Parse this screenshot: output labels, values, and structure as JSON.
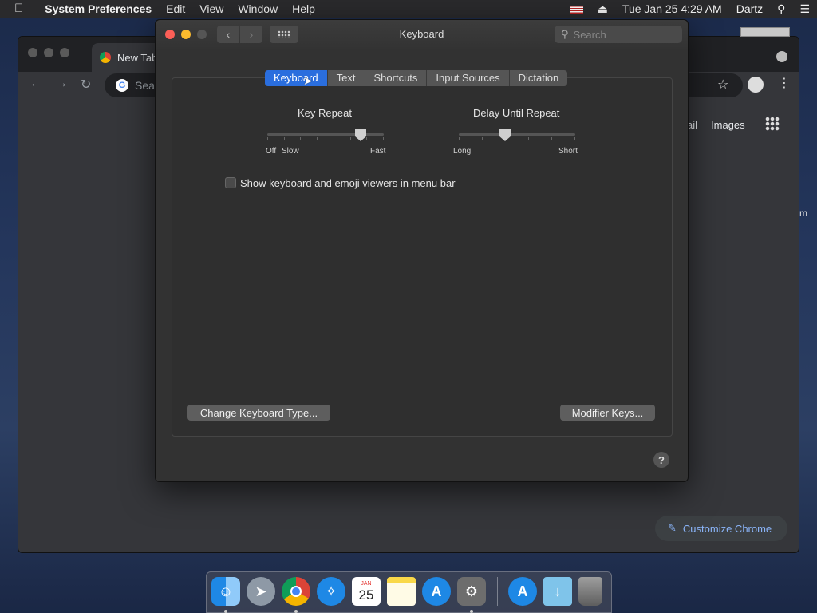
{
  "menubar": {
    "apple_icon": "apple-icon",
    "app_name": "System Preferences",
    "menus": [
      "Edit",
      "View",
      "Window",
      "Help"
    ],
    "datetime": "Tue Jan 25  4:29 AM",
    "user": "Dartz"
  },
  "chrome": {
    "tab_title": "New Tab",
    "omnibox_placeholder": "Sear",
    "link_gmail": "ail",
    "link_images": "Images",
    "customize_label": "Customize Chrome",
    "edge_text": "m"
  },
  "prefs": {
    "title": "Keyboard",
    "search_placeholder": "Search",
    "tabs": [
      "Keyboard",
      "Text",
      "Shortcuts",
      "Input Sources",
      "Dictation"
    ],
    "active_tab": "Keyboard",
    "key_repeat": {
      "label": "Key Repeat",
      "left_labels": [
        "Off",
        "Slow"
      ],
      "right_label": "Fast",
      "value_fraction": 0.8
    },
    "delay_until_repeat": {
      "label": "Delay Until Repeat",
      "left_label": "Long",
      "right_label": "Short",
      "value_fraction": 0.4
    },
    "show_viewers_checkbox": {
      "label": "Show keyboard and emoji viewers in menu bar",
      "checked": false
    },
    "change_keyboard_button": "Change Keyboard Type...",
    "modifier_keys_button": "Modifier Keys...",
    "help_label": "?"
  },
  "dock": {
    "calendar_month": "JAN",
    "calendar_day": "25"
  },
  "colors": {
    "accent": "#2a6ede",
    "menubar_bg": "#2a2a2c",
    "window_bg": "#323232"
  }
}
